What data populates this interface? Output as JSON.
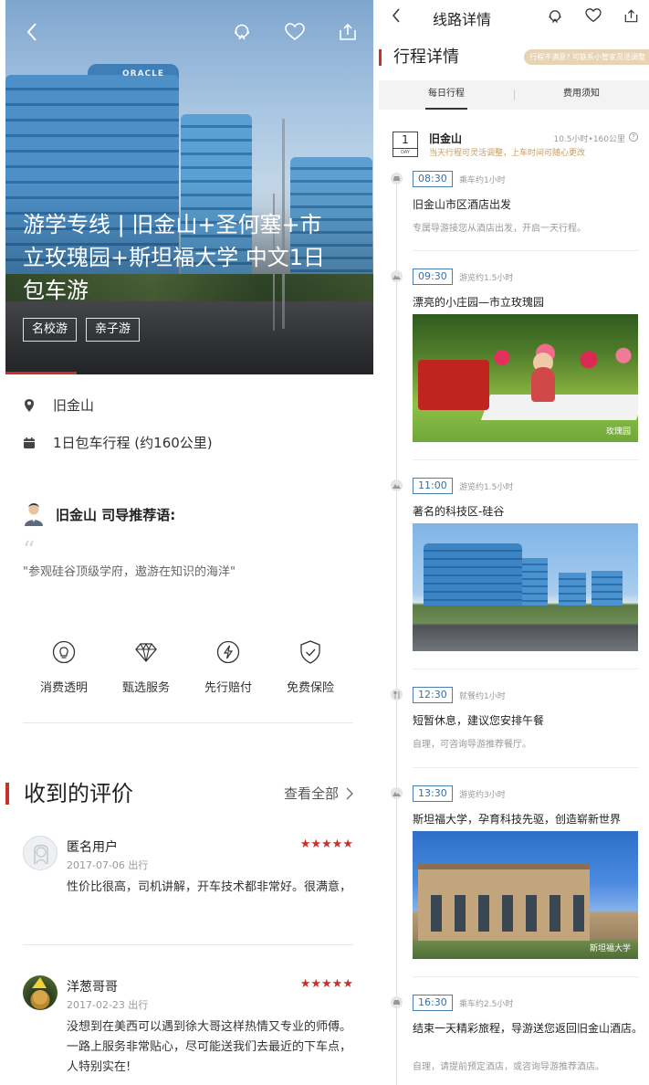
{
  "left": {
    "hero": {
      "title": "游学专线 | 旧金山+圣何塞+市立玫瑰园+斯坦福大学 中文1日包车游",
      "building_sign": "ORACLE",
      "tags": [
        "名校游",
        "亲子游"
      ]
    },
    "info": {
      "location": "旧金山",
      "itinerary": "1日包车行程 (约160公里)"
    },
    "recommendation": {
      "heading": "旧金山 司导推荐语:",
      "text": "\"参观硅谷顶级学府，遨游在知识的海洋\""
    },
    "features": [
      {
        "icon": "lightbulb-icon",
        "label": "消费透明"
      },
      {
        "icon": "diamond-icon",
        "label": "甄选服务"
      },
      {
        "icon": "lightning-icon",
        "label": "先行赔付"
      },
      {
        "icon": "shield-check-icon",
        "label": "免费保险"
      }
    ],
    "reviews": {
      "title": "收到的评价",
      "more_label": "查看全部",
      "items": [
        {
          "name": "匿名用户",
          "date": "2017-07-06 出行",
          "rating": 5,
          "stars": "★★★★★",
          "text": "性价比很高，司机讲解，开车技术都非常好。很满意，"
        },
        {
          "name": "洋葱哥哥",
          "date": "2017-02-23 出行",
          "rating": 5,
          "stars": "★★★★★",
          "text": "没想到在美西可以遇到徐大哥这样热情又专业的师傅。一路上服务非常贴心，尽可能送我们去最近的下车点，人特别实在!"
        }
      ]
    }
  },
  "right": {
    "nav_title": "线路详情",
    "section_title": "行程详情",
    "section_hint": "行程不满意? 可联系小管家灵活调整",
    "tabs": [
      "每日行程",
      "费用须知"
    ],
    "day": {
      "number": "1",
      "label": "DAY",
      "city": "旧金山",
      "meta": "10.5小时•160公里",
      "note": "当天行程可灵活调整，上车时间可随心更改"
    },
    "stops": [
      {
        "icon": "car-icon",
        "time": "08:30",
        "duration": "乘车约1小时",
        "title": "旧金山市区酒店出发",
        "desc": "专属导游接您从酒店出发，开启一天行程。"
      },
      {
        "icon": "sightseeing-icon",
        "time": "09:30",
        "duration": "游览约1.5小时",
        "title": "漂亮的小庄园—市立玫瑰园",
        "photo_caption": "玫瑰园"
      },
      {
        "icon": "sightseeing-icon",
        "time": "11:00",
        "duration": "游览约1.5小时",
        "title": "著名的科技区-硅谷"
      },
      {
        "icon": "dining-icon",
        "time": "12:30",
        "duration": "就餐约1小时",
        "title": "短暂休息，建议您安排午餐",
        "desc": "自理，可咨询导游推荐餐厅。"
      },
      {
        "icon": "sightseeing-icon",
        "time": "13:30",
        "duration": "游览约3小时",
        "title": "斯坦福大学，孕育科技先驱，创造崭新世界",
        "photo_caption": "斯坦福大学"
      },
      {
        "icon": "car-icon",
        "time": "16:30",
        "duration": "乘车约2.5小时",
        "title": "结束一天精彩旅程，导游送您返回旧金山酒店。",
        "desc": "自理，请提前预定酒店，或咨询导游推荐酒店。"
      }
    ]
  },
  "colors": {
    "accent": "#c9302c",
    "time_border": "#4a7fb3",
    "hint_bg": "#e8d3b4",
    "note_text": "#c89a5a"
  }
}
